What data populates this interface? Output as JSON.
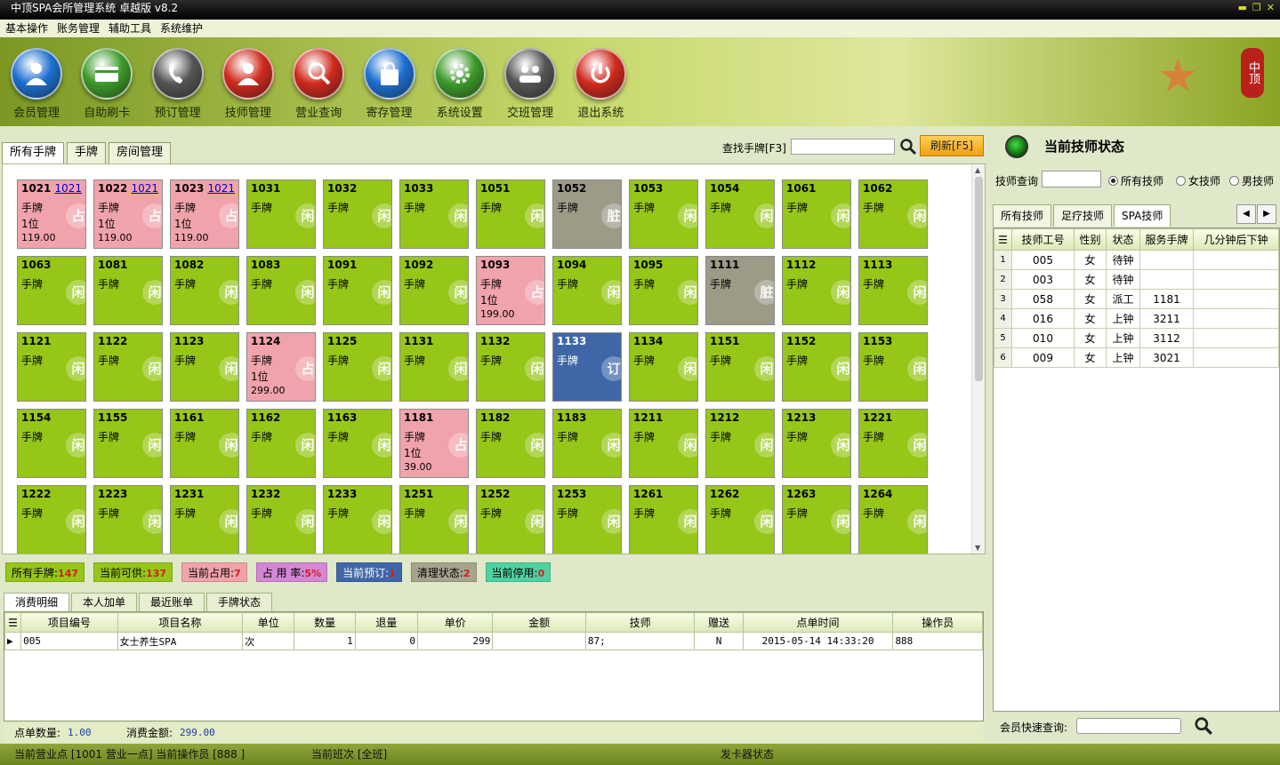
{
  "window": {
    "title": "中顶SPA会所管理系统 卓越版 v8.2"
  },
  "menu": [
    "基本操作",
    "账务管理",
    "辅助工具",
    "系统维护"
  ],
  "toolbar": [
    {
      "label": "会员管理",
      "icon": "member-icon",
      "color": "#1d6fd1"
    },
    {
      "label": "自助刷卡",
      "icon": "card-icon",
      "color": "#3d9a2a"
    },
    {
      "label": "预订管理",
      "icon": "phone-icon",
      "color": "#555555"
    },
    {
      "label": "技师管理",
      "icon": "technician-icon",
      "color": "#d02a1e"
    },
    {
      "label": "营业查询",
      "icon": "magnifier-icon",
      "color": "#d02a1e"
    },
    {
      "label": "寄存管理",
      "icon": "bag-icon",
      "color": "#1d6fd1"
    },
    {
      "label": "系统设置",
      "icon": "gear-icon",
      "color": "#3d9a2a"
    },
    {
      "label": "交班管理",
      "icon": "handover-icon",
      "color": "#555555"
    },
    {
      "label": "退出系统",
      "icon": "power-icon",
      "color": "#d02a1e"
    }
  ],
  "logo": {
    "seal_text": "中顶"
  },
  "main_tabs": [
    "所有手牌",
    "手牌",
    "房间管理"
  ],
  "search": {
    "label": "查找手牌[F3]",
    "value": "",
    "refresh_label": "刷新[F5]"
  },
  "cards": [
    {
      "num": "1021",
      "link": "1021",
      "type": "手牌",
      "seat": "1位",
      "price": "119.00",
      "status": "occ",
      "badge": "占"
    },
    {
      "num": "1022",
      "link": "1021",
      "type": "手牌",
      "seat": "1位",
      "price": "119.00",
      "status": "occ",
      "badge": "占"
    },
    {
      "num": "1023",
      "link": "1021",
      "type": "手牌",
      "seat": "1位",
      "price": "119.00",
      "status": "occ",
      "badge": "占"
    },
    {
      "num": "1031",
      "type": "手牌",
      "status": "free",
      "badge": "闲"
    },
    {
      "num": "1032",
      "type": "手牌",
      "status": "free",
      "badge": "闲"
    },
    {
      "num": "1033",
      "type": "手牌",
      "status": "free",
      "badge": "闲"
    },
    {
      "num": "1051",
      "type": "手牌",
      "status": "free",
      "badge": "闲"
    },
    {
      "num": "1052",
      "type": "手牌",
      "status": "dirty",
      "badge": "脏"
    },
    {
      "num": "1053",
      "type": "手牌",
      "status": "free",
      "badge": "闲"
    },
    {
      "num": "1054",
      "type": "手牌",
      "status": "free",
      "badge": "闲"
    },
    {
      "num": "1061",
      "type": "手牌",
      "status": "free",
      "badge": "闲"
    },
    {
      "num": "1062",
      "type": "手牌",
      "status": "free",
      "badge": "闲"
    },
    {
      "num": "1063",
      "type": "手牌",
      "status": "free",
      "badge": "闲"
    },
    {
      "num": "1081",
      "type": "手牌",
      "status": "free",
      "badge": "闲"
    },
    {
      "num": "1082",
      "type": "手牌",
      "status": "free",
      "badge": "闲"
    },
    {
      "num": "1083",
      "type": "手牌",
      "status": "free",
      "badge": "闲"
    },
    {
      "num": "1091",
      "type": "手牌",
      "status": "free",
      "badge": "闲"
    },
    {
      "num": "1092",
      "type": "手牌",
      "status": "free",
      "badge": "闲"
    },
    {
      "num": "1093",
      "type": "手牌",
      "seat": "1位",
      "price": "199.00",
      "status": "occ",
      "badge": "占"
    },
    {
      "num": "1094",
      "type": "手牌",
      "status": "free",
      "badge": "闲"
    },
    {
      "num": "1095",
      "type": "手牌",
      "status": "free",
      "badge": "闲"
    },
    {
      "num": "1111",
      "type": "手牌",
      "status": "dirty",
      "badge": "脏"
    },
    {
      "num": "1112",
      "type": "手牌",
      "status": "free",
      "badge": "闲"
    },
    {
      "num": "1113",
      "type": "手牌",
      "status": "free",
      "badge": "闲"
    },
    {
      "num": "1121",
      "type": "手牌",
      "status": "free",
      "badge": "闲"
    },
    {
      "num": "1122",
      "type": "手牌",
      "status": "free",
      "badge": "闲"
    },
    {
      "num": "1123",
      "type": "手牌",
      "status": "free",
      "badge": "闲"
    },
    {
      "num": "1124",
      "type": "手牌",
      "seat": "1位",
      "price": "299.00",
      "status": "occ",
      "badge": "占"
    },
    {
      "num": "1125",
      "type": "手牌",
      "status": "free",
      "badge": "闲"
    },
    {
      "num": "1131",
      "type": "手牌",
      "status": "free",
      "badge": "闲"
    },
    {
      "num": "1132",
      "type": "手牌",
      "status": "free",
      "badge": "闲"
    },
    {
      "num": "1133",
      "type": "手牌",
      "status": "booked",
      "badge": "订"
    },
    {
      "num": "1134",
      "type": "手牌",
      "status": "free",
      "badge": "闲"
    },
    {
      "num": "1151",
      "type": "手牌",
      "status": "free",
      "badge": "闲"
    },
    {
      "num": "1152",
      "type": "手牌",
      "status": "free",
      "badge": "闲"
    },
    {
      "num": "1153",
      "type": "手牌",
      "status": "free",
      "badge": "闲"
    },
    {
      "num": "1154",
      "type": "手牌",
      "status": "free",
      "badge": "闲"
    },
    {
      "num": "1155",
      "type": "手牌",
      "status": "free",
      "badge": "闲"
    },
    {
      "num": "1161",
      "type": "手牌",
      "status": "free",
      "badge": "闲"
    },
    {
      "num": "1162",
      "type": "手牌",
      "status": "free",
      "badge": "闲"
    },
    {
      "num": "1163",
      "type": "手牌",
      "status": "free",
      "badge": "闲"
    },
    {
      "num": "1181",
      "type": "手牌",
      "seat": "1位",
      "price": "39.00",
      "status": "occ",
      "badge": "占"
    },
    {
      "num": "1182",
      "type": "手牌",
      "status": "free",
      "badge": "闲"
    },
    {
      "num": "1183",
      "type": "手牌",
      "status": "free",
      "badge": "闲"
    },
    {
      "num": "1211",
      "type": "手牌",
      "status": "free",
      "badge": "闲"
    },
    {
      "num": "1212",
      "type": "手牌",
      "status": "free",
      "badge": "闲"
    },
    {
      "num": "1213",
      "type": "手牌",
      "status": "free",
      "badge": "闲"
    },
    {
      "num": "1221",
      "type": "手牌",
      "status": "free",
      "badge": "闲"
    },
    {
      "num": "1222",
      "type": "手牌",
      "status": "free",
      "badge": "闲"
    },
    {
      "num": "1223",
      "type": "手牌",
      "status": "free",
      "badge": "闲"
    },
    {
      "num": "1231",
      "type": "手牌",
      "status": "free",
      "badge": "闲"
    },
    {
      "num": "1232",
      "type": "手牌",
      "status": "free",
      "badge": "闲"
    },
    {
      "num": "1233",
      "type": "手牌",
      "status": "free",
      "badge": "闲"
    },
    {
      "num": "1251",
      "type": "手牌",
      "status": "free",
      "badge": "闲"
    },
    {
      "num": "1252",
      "type": "手牌",
      "status": "free",
      "badge": "闲"
    },
    {
      "num": "1253",
      "type": "手牌",
      "status": "free",
      "badge": "闲"
    },
    {
      "num": "1261",
      "type": "手牌",
      "status": "free",
      "badge": "闲"
    },
    {
      "num": "1262",
      "type": "手牌",
      "status": "free",
      "badge": "闲"
    },
    {
      "num": "1263",
      "type": "手牌",
      "status": "free",
      "badge": "闲"
    },
    {
      "num": "1264",
      "type": "手牌",
      "status": "free",
      "badge": "闲"
    }
  ],
  "status_bar": [
    {
      "label": "所有手牌:",
      "value": "147",
      "bg": "#96c618",
      "vcolor": "#d81b1b"
    },
    {
      "label": "当前可供:",
      "value": "137",
      "bg": "#96c618",
      "vcolor": "#d81b1b"
    },
    {
      "label": "当前占用:",
      "value": "7",
      "bg": "#f1a3ab",
      "vcolor": "#d81b1b"
    },
    {
      "label": "占 用 率:",
      "value": "5%",
      "bg": "#d487d4",
      "vcolor": "#d81b1b"
    },
    {
      "label": "当前预订:",
      "value": "1",
      "bg": "#3f67a8",
      "vcolor": "#d81b1b"
    },
    {
      "label": "清理状态:",
      "value": "2",
      "bg": "#a6a48e",
      "vcolor": "#d81b1b"
    },
    {
      "label": "当前停用:",
      "value": "0",
      "bg": "#4fd2a2",
      "vcolor": "#d81b1b"
    }
  ],
  "bottom_tabs": [
    "消费明细",
    "本人加单",
    "最近账单",
    "手牌状态"
  ],
  "detail": {
    "columns": [
      "项目编号",
      "项目名称",
      "单位",
      "数量",
      "退量",
      "单价",
      "金额",
      "技师",
      "赠送",
      "点单时间",
      "操作员"
    ],
    "rows": [
      [
        "005",
        "女士养生SPA",
        "次",
        "1",
        "0",
        "299",
        "",
        "87;",
        "N",
        "2015-05-14 14:33:20",
        "888"
      ]
    ]
  },
  "summary": {
    "count_label": "点单数量:",
    "count_value": "1.00",
    "amount_label": "消费金额:",
    "amount_value": "299.00"
  },
  "right": {
    "title": "当前技师状态",
    "query_label": "技师查询",
    "radios": [
      {
        "label": "所有技师",
        "checked": true
      },
      {
        "label": "女技师",
        "checked": false
      },
      {
        "label": "男技师",
        "checked": false
      }
    ],
    "tabs": [
      "所有技师",
      "足疗技师",
      "SPA技师"
    ],
    "columns": [
      "技师工号",
      "性别",
      "状态",
      "服务手牌",
      "几分钟后下钟"
    ],
    "rows": [
      {
        "idx": "1",
        "id": "005",
        "sex": "女",
        "status": "待钟",
        "card": "",
        "remain": ""
      },
      {
        "idx": "2",
        "id": "003",
        "sex": "女",
        "status": "待钟",
        "card": "",
        "remain": ""
      },
      {
        "idx": "3",
        "id": "058",
        "sex": "女",
        "status": "派工",
        "card": "1181",
        "remain": ""
      },
      {
        "idx": "4",
        "id": "016",
        "sex": "女",
        "status": "上钟",
        "card": "3211",
        "remain": ""
      },
      {
        "idx": "5",
        "id": "010",
        "sex": "女",
        "status": "上钟",
        "card": "3112",
        "remain": ""
      },
      {
        "idx": "6",
        "id": "009",
        "sex": "女",
        "status": "上钟",
        "card": "3021",
        "remain": ""
      }
    ],
    "member_query_label": "会员快速查询:"
  },
  "footer": {
    "location": "当前营业点 [1001 营业一点] 当前操作员 [888 ]",
    "shift": "当前班次 [全班]",
    "card_reader": "发卡器状态"
  }
}
